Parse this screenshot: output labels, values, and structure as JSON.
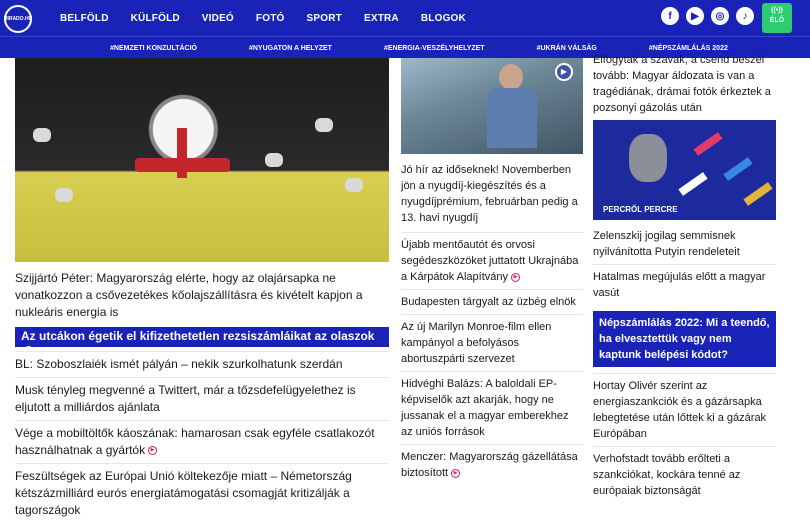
{
  "header": {
    "logo_text": "HIRADO.HU",
    "nav": [
      "BELFÖLD",
      "KÜLFÖLD",
      "VIDEÓ",
      "FOTÓ",
      "SPORT",
      "EXTRA",
      "BLOGOK"
    ],
    "socials": [
      "f",
      "▶",
      "◎",
      "♪"
    ],
    "live_label": "ÉLŐ"
  },
  "tags": [
    "#NEMZETI KONZULTÁCIÓ",
    "#NYUGATON A HELYZET",
    "#ENERGIA-VESZÉLYHELYZET",
    "#UKRÁN VÁLSÁG",
    "#NÉPSZÁMLÁLÁS 2022"
  ],
  "col1": {
    "main_headline": "Szijjártó Péter: Magyarország elérte, hogy az olajársapka ne vonatkozzon a csővezetékes kőolajszállításra és kivételt kapjon a nukleáris energia is",
    "banner": "Az utcákon égetik el kifizethetetlen rezsiszámláikat az olaszok",
    "items": [
      "BL: Szoboszlaiék ismét pályán – nekik szurkolhatunk szerdán",
      "Musk tényleg megvenné a Twittert, már a tőzsdefelügyelethez is eljutott a milliárdos ajánlata",
      "Vége a mobiltöltők káoszának: hamarosan csak egyféle csatlakozót használhatnak a gyártók",
      "Feszültségek az Európai Unió költekezője miatt – Németország kétszázmilliárd eurós energiatámogatási csomagját kritizálják a tagországok"
    ]
  },
  "col2": {
    "main_headline": "Jó hír az időseknek! Novemberben jön a nyugdíj-kiegészítés és a nyugdíjprémium, februárban pedig a 13. havi nyugdíj",
    "items": [
      "Újabb mentőautót és orvosi segédeszközöket juttatott Ukrajnába a Kárpátok Alapítvány",
      "Budapesten tárgyalt az üzbég elnök",
      "Az új Marilyn Monroe-film ellen kampányol a befolyásos abortuszpárti szervezet",
      "Hidvéghi Balázs: A baloldali EP-képviselők azt akarják, hogy ne jussanak el a magyar emberekhez az uniós források",
      "Menczer: Magyarország gázellátása biztosított"
    ]
  },
  "col3": {
    "top_text": "Elfogytak a szavak, a csend beszél tovább: Magyar áldozata is van a tragédiának, drámai fotók érkeztek a pozsonyi gázolás után",
    "live_label": "PERCRŐL PERCRE",
    "item1": "Zelenszkij jogilag semmisnek nyilvánította Putyin rendeleteit",
    "item2": "Hatalmas megújulás előtt a magyar vasút",
    "boxed": "Népszámlálás 2022: Mi a teendő, ha elvesztettük vagy nem kaptunk belépési kódot?",
    "item3": "Hortay Olivér szerint az energiaszankciók és a gázársapka lebegtetése után lőttek ki a gázárak Európában",
    "item4": "Verhofstadt tovább erőlteti a szankciókat, kockára tenné az európaiak biztonságát"
  },
  "colors": {
    "brand": "#1a23b8",
    "accent": "#d11f6b",
    "live": "#2ecc71"
  }
}
